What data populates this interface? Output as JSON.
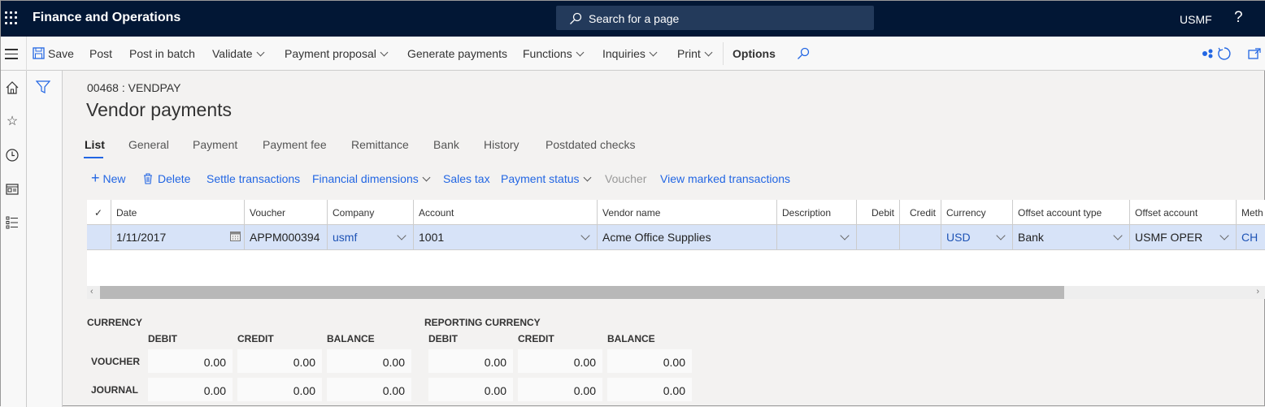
{
  "topbar": {
    "app_title": "Finance and Operations",
    "search_placeholder": "Search for a page",
    "company": "USMF",
    "help": "?"
  },
  "actionbar": {
    "items": [
      {
        "label": "Save",
        "icon": "save-icon"
      },
      {
        "label": "Post"
      },
      {
        "label": "Post in batch"
      },
      {
        "label": "Validate",
        "dropdown": true
      },
      {
        "label": "Payment proposal",
        "dropdown": true
      },
      {
        "label": "Generate payments"
      },
      {
        "label": "Functions",
        "dropdown": true
      },
      {
        "label": "Inquiries",
        "dropdown": true
      },
      {
        "label": "Print",
        "dropdown": true
      },
      {
        "label": "Options"
      }
    ],
    "right_icons": [
      "office-integration-icon",
      "refresh-icon",
      "open-new-window-icon"
    ]
  },
  "left_nav": [
    "home-icon",
    "favorites-star-icon",
    "recent-clock-icon",
    "workspaces-icon",
    "modules-list-icon"
  ],
  "page": {
    "caption": "00468 : VENDPAY",
    "title": "Vendor payments"
  },
  "tabs": [
    {
      "label": "List",
      "active": true
    },
    {
      "label": "General"
    },
    {
      "label": "Payment"
    },
    {
      "label": "Payment fee"
    },
    {
      "label": "Remittance"
    },
    {
      "label": "Bank"
    },
    {
      "label": "History"
    },
    {
      "label": "Postdated checks"
    }
  ],
  "grid_actions": [
    {
      "label": "New",
      "icon": "plus-icon"
    },
    {
      "label": "Delete",
      "icon": "trash-icon"
    },
    {
      "label": "Settle transactions"
    },
    {
      "label": "Financial dimensions",
      "dropdown": true
    },
    {
      "label": "Sales tax"
    },
    {
      "label": "Payment status",
      "dropdown": true
    },
    {
      "label": "Voucher",
      "disabled": true
    },
    {
      "label": "View marked transactions"
    }
  ],
  "grid": {
    "columns": [
      "Date",
      "Voucher",
      "Company",
      "Account",
      "Vendor name",
      "Description",
      "Debit",
      "Credit",
      "Currency",
      "Offset account type",
      "Offset account",
      "Meth"
    ],
    "rows": [
      {
        "date": "1/11/2017",
        "voucher": "APPM000394",
        "company": "usmf",
        "account": "1001",
        "vendor_name": "Acme Office Supplies",
        "description": "",
        "debit": "",
        "credit": "",
        "currency": "USD",
        "offset_account_type": "Bank",
        "offset_account": "USMF OPER",
        "method": "CH"
      }
    ]
  },
  "summary": {
    "currency_title": "CURRENCY",
    "reporting_title": "REPORTING CURRENCY",
    "col_headers": [
      "DEBIT",
      "CREDIT",
      "BALANCE"
    ],
    "row_labels": [
      "VOUCHER",
      "JOURNAL"
    ],
    "currency": {
      "voucher": [
        "0.00",
        "0.00",
        "0.00"
      ],
      "journal": [
        "0.00",
        "0.00",
        "0.00"
      ]
    },
    "reporting": {
      "voucher": [
        "0.00",
        "0.00",
        "0.00"
      ],
      "journal": [
        "0.00",
        "0.00",
        "0.00"
      ]
    }
  }
}
